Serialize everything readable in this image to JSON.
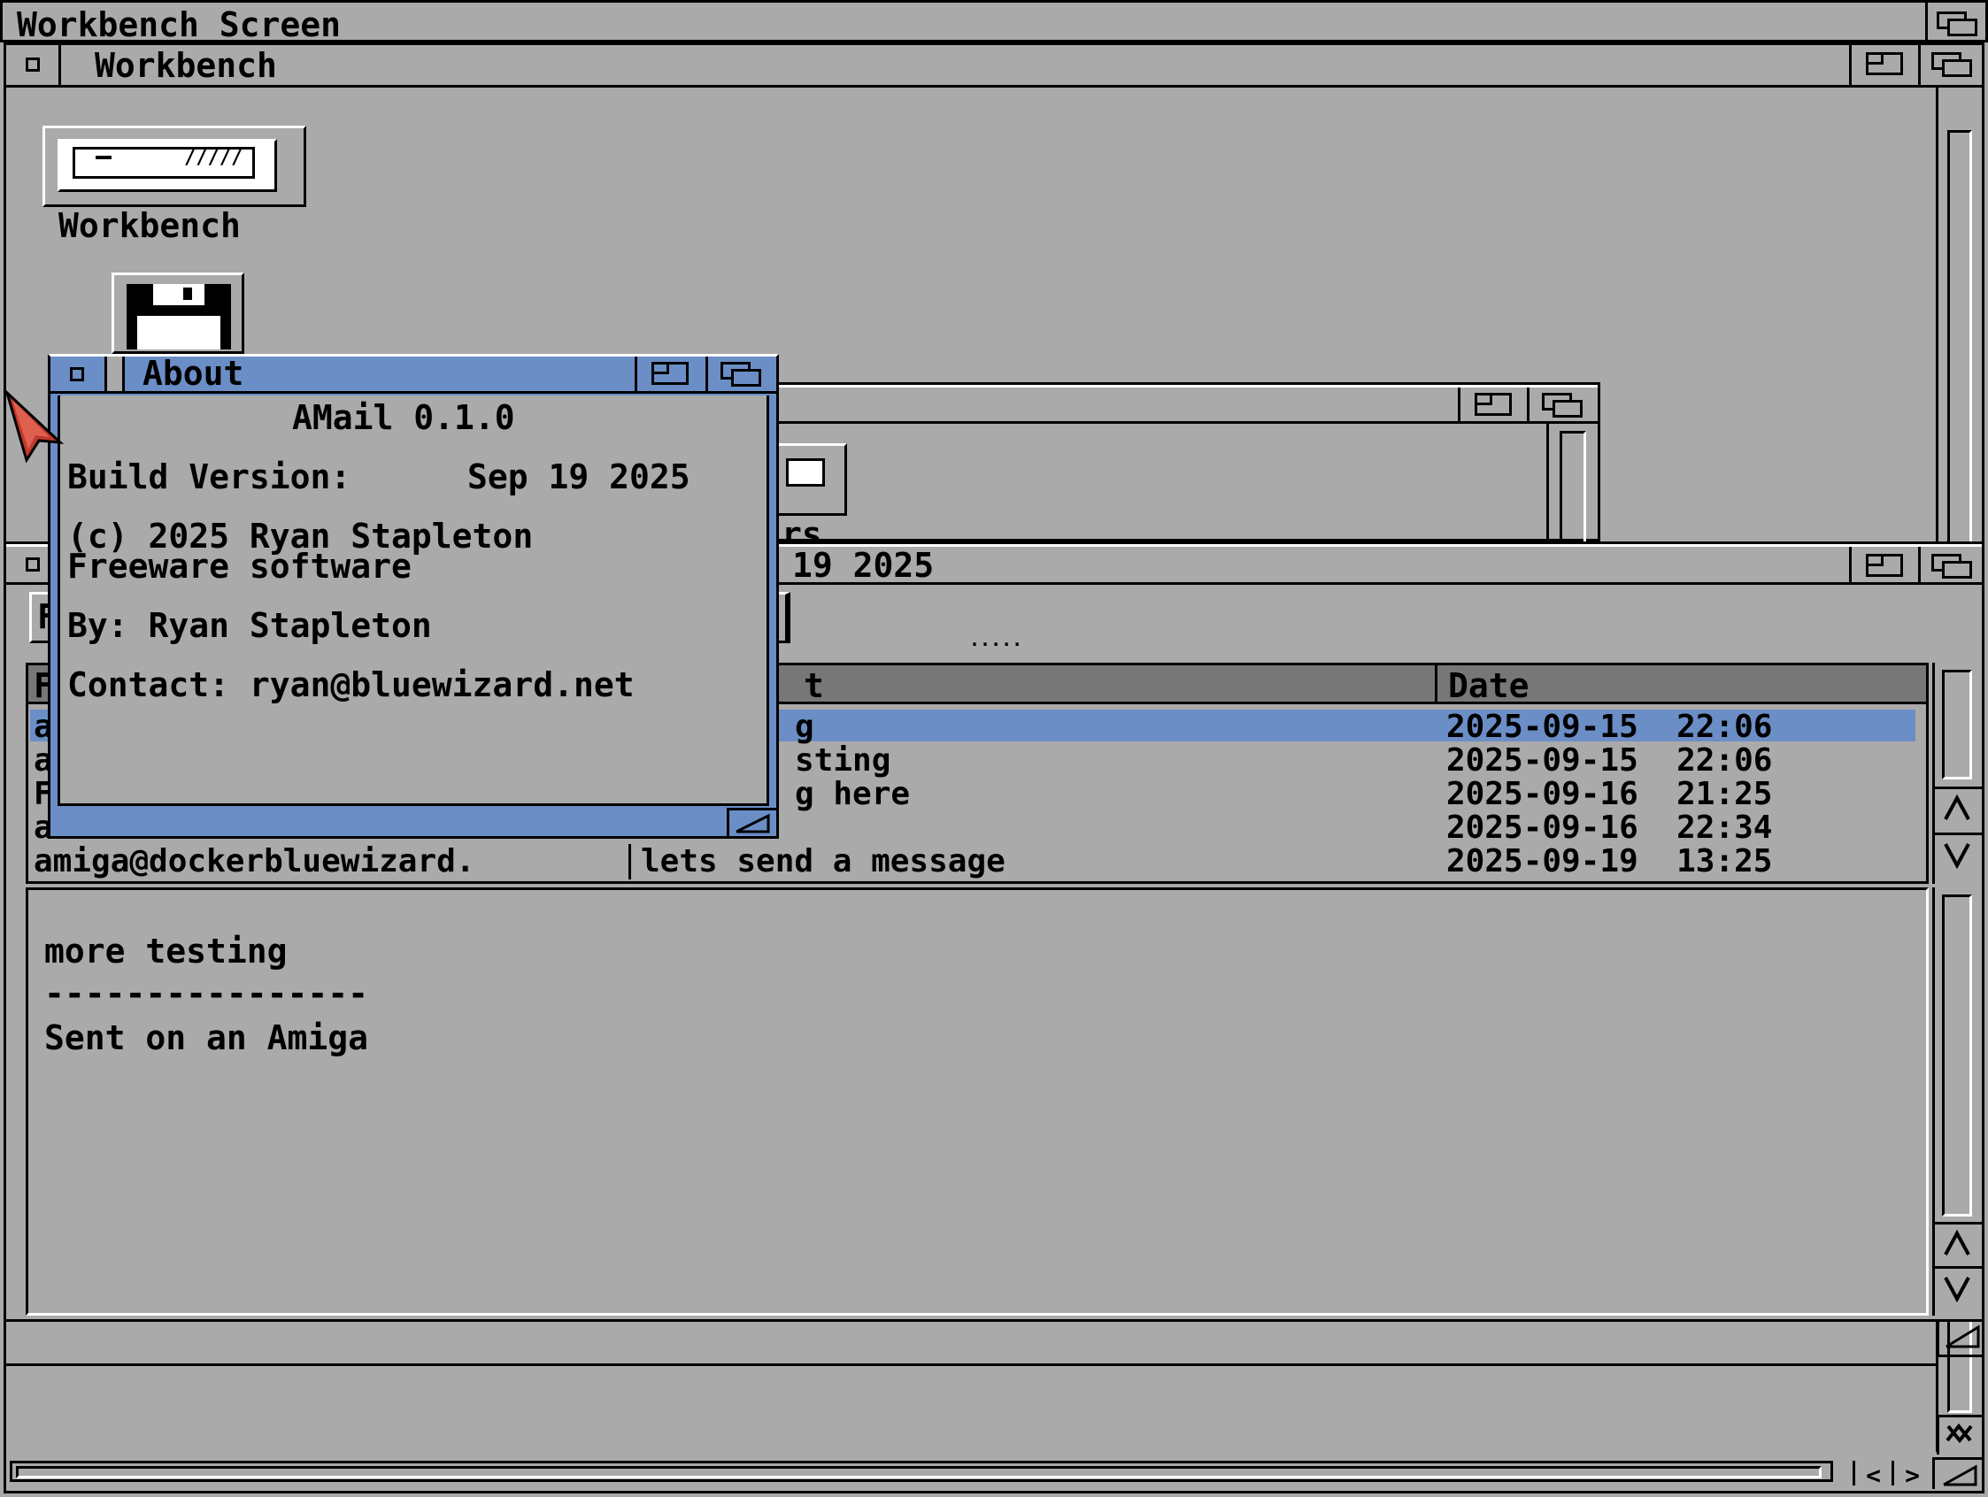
{
  "screen": {
    "title": "Workbench Screen"
  },
  "workbench_window": {
    "title": "Workbench"
  },
  "icons": {
    "workbench_drive": "Workbench",
    "rear_icon_fragment": "rs"
  },
  "amail_window": {
    "title_fragment": "19 2025",
    "columns": {
      "from": "F",
      "subject": "t",
      "date": "Date"
    },
    "rows": [
      {
        "from": "a",
        "subject": "g",
        "date": "2025-09-15  22:06",
        "selected": true
      },
      {
        "from": "a",
        "subject": "sting",
        "date": "2025-09-15  22:06",
        "selected": false
      },
      {
        "from": "F",
        "subject": "g here",
        "date": "2025-09-16  21:25",
        "selected": false
      },
      {
        "from": "a",
        "subject": "",
        "date": "2025-09-16  22:34",
        "selected": false
      },
      {
        "from": "amiga@dockerbluewizard.",
        "subject": "lets send a message",
        "date": "2025-09-19  13:25",
        "selected": false
      }
    ],
    "toolbar_fragment": "F",
    "divider_dots": ".....",
    "message_lines": [
      "more testing",
      "",
      "----------------",
      "Sent on an Amiga"
    ]
  },
  "about_window": {
    "title": "About",
    "app_name": "AMail 0.1.0",
    "build_label": "Build Version:",
    "build_date": "Sep 19 2025",
    "copyright": "(c) 2025 Ryan Stapleton",
    "license": "Freeware software",
    "by": "By: Ryan Stapleton",
    "contact": "Contact: ryan@bluewizard.net"
  },
  "colors": {
    "desktop_grey": "#aaaaaa",
    "accent_blue": "#6b8ec6",
    "pointer_red": "#c0392b"
  }
}
